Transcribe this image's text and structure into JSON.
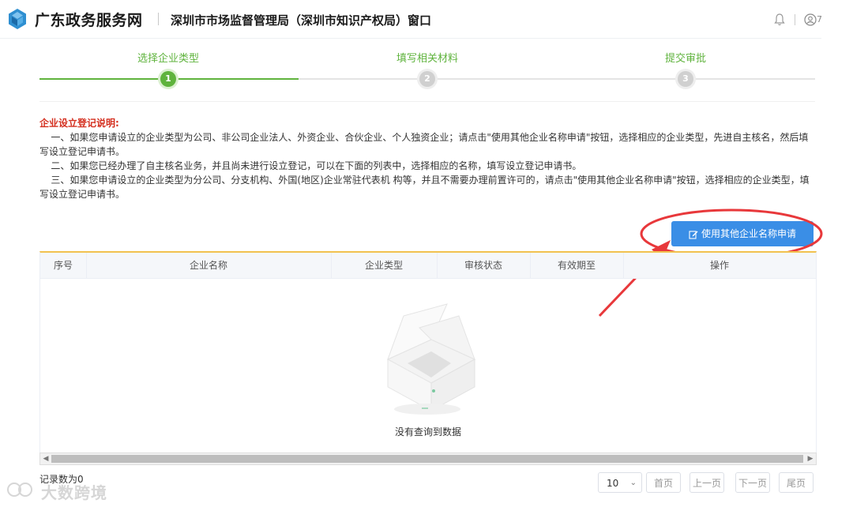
{
  "header": {
    "brand": "广东政务服务网",
    "dept": "深圳市市场监督管理局（深圳市知识产权局）窗口",
    "user_trail": "7"
  },
  "steps": [
    {
      "label": "选择企业类型",
      "num": "1",
      "state": "active"
    },
    {
      "label": "填写相关材料",
      "num": "2",
      "state": "inactive"
    },
    {
      "label": "提交审批",
      "num": "3",
      "state": "inactive"
    }
  ],
  "notice": {
    "title": "企业设立登记说明:",
    "line1": "一、如果您申请设立的企业类型为公司、非公司企业法人、外资企业、合伙企业、个人独资企业；请点击\"使用其他企业名称申请\"按钮，选择相应的企业类型，先进自主核名，然后填写设立登记申请书。",
    "line2": "二、如果您已经办理了自主核名业务，并且尚未进行设立登记，可以在下面的列表中，选择相应的名称，填写设立登记申请书。",
    "line3": "三、如果您申请设立的企业类型为分公司、分支机构、外国(地区)企业常驻代表机 构等，并且不需要办理前置许可的，请点击\"使用其他企业名称申请\"按钮，选择相应的企业类型，填写设立登记申请书。"
  },
  "apply_button": "使用其他企业名称申请",
  "table": {
    "columns": [
      "序号",
      "企业名称",
      "企业类型",
      "审核状态",
      "有效期至",
      "操作"
    ],
    "rows": [],
    "empty_text": "没有查询到数据"
  },
  "footer": {
    "record_count": "记录数为0",
    "page_size": "10",
    "first": "首页",
    "prev": "上一页",
    "next": "下一页",
    "last": "尾页",
    "watermark": "大数跨境"
  },
  "colors": {
    "accent_green": "#5fb33d",
    "button_blue": "#3a8ee6",
    "notice_red": "#d42f1f",
    "table_top_border": "#f2c24f"
  }
}
